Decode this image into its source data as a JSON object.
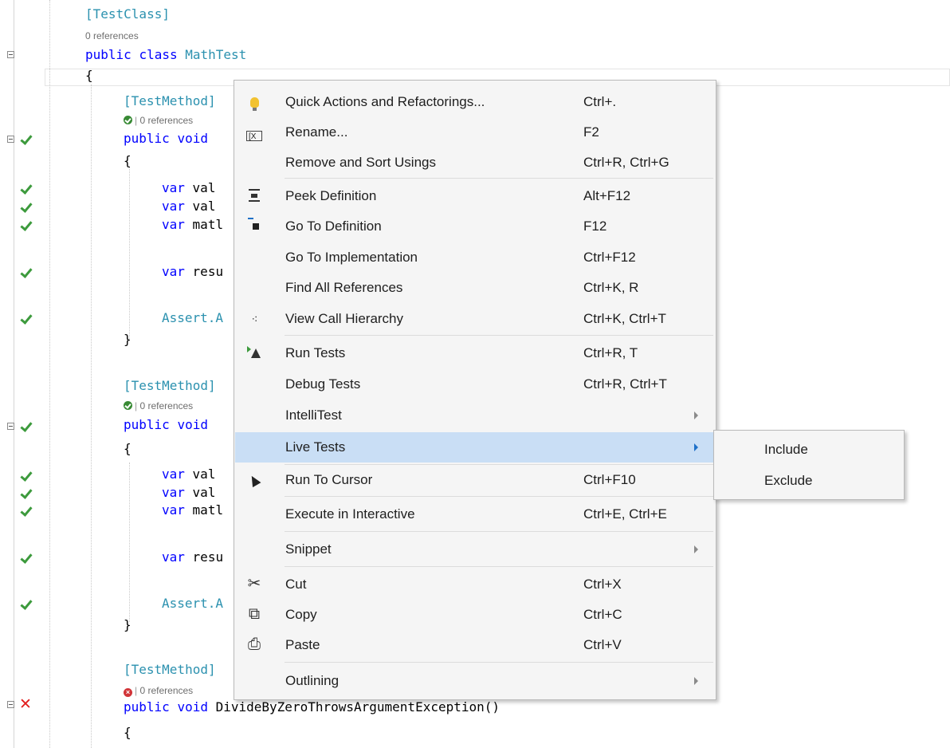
{
  "code": {
    "attr_test_class": "[TestClass]",
    "references_label": "0 references",
    "class_kw1": "public",
    "class_kw2": "class",
    "class_name": "MathTest",
    "open_brace": "{",
    "close_brace": "}",
    "attr_test_method": "[TestMethod]",
    "public_kw": "public",
    "void_kw": "void",
    "var_kw": "var",
    "val_fragment": "val",
    "math_fragment": "matl",
    "res_fragment": "resu",
    "assert_fragment": "Assert.A",
    "method3_name": "DivideByZeroThrowsArgumentException()",
    "lens_sep": "|"
  },
  "menu": {
    "items": [
      {
        "label": "Quick Actions and Refactorings...",
        "shortcut": "Ctrl+.",
        "icon": "lightbulb-icon"
      },
      {
        "label": "Rename...",
        "shortcut": "F2",
        "icon": "rename-icon"
      },
      {
        "label": "Remove and Sort Usings",
        "shortcut": "Ctrl+R, Ctrl+G",
        "icon": ""
      },
      {
        "label": "Peek Definition",
        "shortcut": "Alt+F12",
        "icon": "peek-definition-icon"
      },
      {
        "label": "Go To Definition",
        "shortcut": "F12",
        "icon": "go-to-definition-icon"
      },
      {
        "label": "Go To Implementation",
        "shortcut": "Ctrl+F12",
        "icon": ""
      },
      {
        "label": "Find All References",
        "shortcut": "Ctrl+K, R",
        "icon": ""
      },
      {
        "label": "View Call Hierarchy",
        "shortcut": "Ctrl+K, Ctrl+T",
        "icon": "call-hierarchy-icon"
      },
      {
        "label": "Run Tests",
        "shortcut": "Ctrl+R, T",
        "icon": "run-tests-icon"
      },
      {
        "label": "Debug Tests",
        "shortcut": "Ctrl+R, Ctrl+T",
        "icon": ""
      },
      {
        "label": "IntelliTest",
        "shortcut": "",
        "icon": ""
      },
      {
        "label": "Live Tests",
        "shortcut": "",
        "icon": ""
      },
      {
        "label": "Run To Cursor",
        "shortcut": "Ctrl+F10",
        "icon": "cursor-icon"
      },
      {
        "label": "Execute in Interactive",
        "shortcut": "Ctrl+E, Ctrl+E",
        "icon": ""
      },
      {
        "label": "Snippet",
        "shortcut": "",
        "icon": ""
      },
      {
        "label": "Cut",
        "shortcut": "Ctrl+X",
        "icon": "scissors-icon"
      },
      {
        "label": "Copy",
        "shortcut": "Ctrl+C",
        "icon": "copy-icon"
      },
      {
        "label": "Paste",
        "shortcut": "Ctrl+V",
        "icon": "paste-icon"
      },
      {
        "label": "Outlining",
        "shortcut": "",
        "icon": ""
      }
    ],
    "highlighted_item": "Live Tests",
    "icon_glyphs": {
      "hierarchy": "⁖",
      "cut": "✂",
      "copy": "⧉",
      "paste": "⎙",
      "rename": "[X"
    }
  },
  "submenu": {
    "items": [
      "Include",
      "Exclude"
    ]
  },
  "colors": {
    "keyword": "#0000ff",
    "type": "#2b91af",
    "menu_bg": "#f5f5f5",
    "menu_highlight": "#c9def5",
    "pass_green": "#3c9a3c",
    "fail_red": "#e21e1e"
  }
}
